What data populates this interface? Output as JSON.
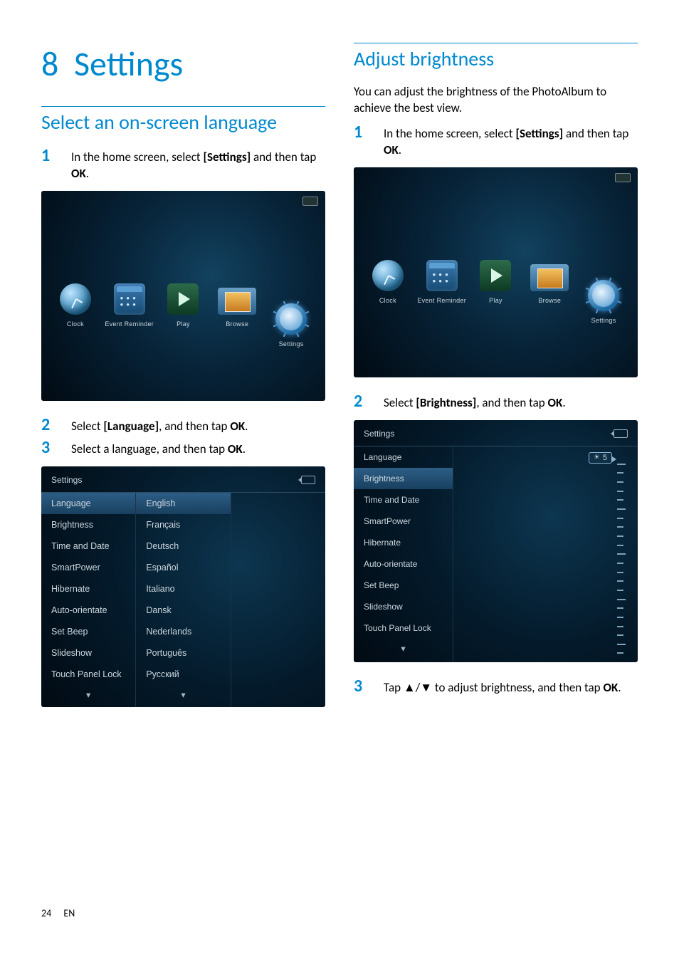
{
  "chapter": {
    "num": "8",
    "title": "Settings"
  },
  "left": {
    "section_title": "Select an on-screen language",
    "steps": [
      {
        "num": "1",
        "html": "In the home screen, select <b>[Settings]</b> and then tap <b>OK</b>."
      },
      {
        "num": "2",
        "html": "Select <b>[Language]</b>, and then tap <b>OK</b>."
      },
      {
        "num": "3",
        "html": "Select a language, and then tap <b>OK</b>."
      }
    ],
    "home_items": [
      "Clock",
      "Event Reminder",
      "Play",
      "Browse",
      "Settings"
    ],
    "settings_title": "Settings",
    "settings_list": [
      "Language",
      "Brightness",
      "Time and Date",
      "SmartPower",
      "Hibernate",
      "Auto-orientate",
      "Set Beep",
      "Slideshow",
      "Touch Panel Lock"
    ],
    "settings_selected": "Language",
    "language_options": [
      "English",
      "Français",
      "Deutsch",
      "Español",
      "Italiano",
      "Dansk",
      "Nederlands",
      "Português",
      "Русский"
    ],
    "language_selected": "English"
  },
  "right": {
    "section_title": "Adjust brightness",
    "intro": "You can adjust the brightness of the PhotoAlbum to achieve the best view.",
    "steps": [
      {
        "num": "1",
        "html": "In the home screen, select <b>[Settings]</b> and then tap <b>OK</b>."
      },
      {
        "num": "2",
        "html": "Select <b>[Brightness]</b>, and then tap <b>OK</b>."
      },
      {
        "num": "3",
        "html": "Tap ▲/▼ to adjust brightness, and then tap <b>OK</b>."
      }
    ],
    "home_items": [
      "Clock",
      "Event Reminder",
      "Play",
      "Browse",
      "Settings"
    ],
    "settings_title": "Settings",
    "settings_list": [
      "Language",
      "Brightness",
      "Time and Date",
      "SmartPower",
      "Hibernate",
      "Auto-orientate",
      "Set Beep",
      "Slideshow",
      "Touch Panel Lock"
    ],
    "settings_selected": "Brightness",
    "brightness_value": "5"
  },
  "footer": {
    "page": "24",
    "lang": "EN"
  }
}
